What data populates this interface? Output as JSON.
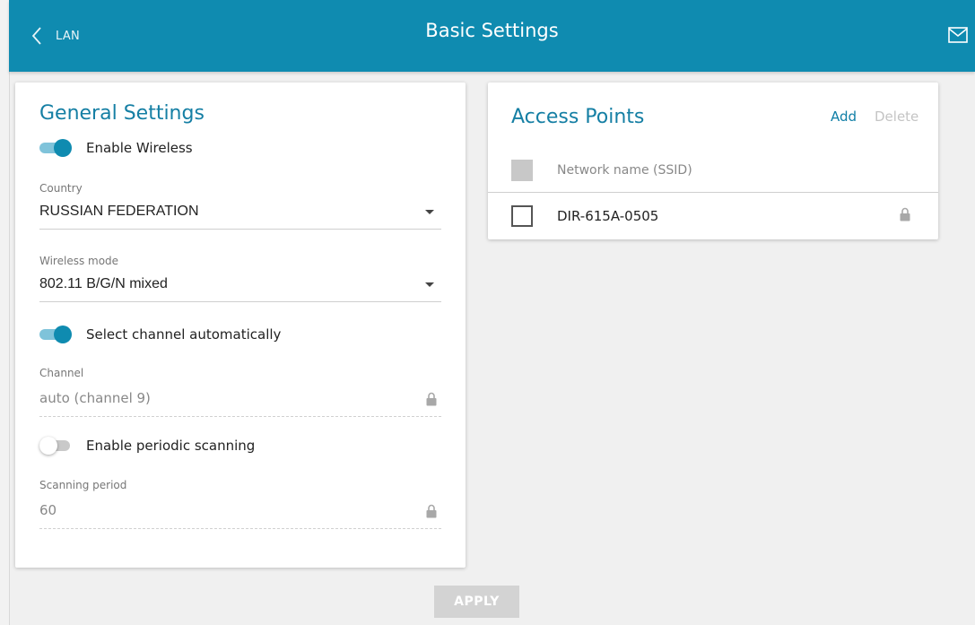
{
  "header": {
    "back_label": "LAN",
    "title": "Basic Settings"
  },
  "general": {
    "title": "General Settings",
    "enable_wireless": {
      "label": "Enable Wireless",
      "on": true
    },
    "country": {
      "label": "Country",
      "value": "RUSSIAN FEDERATION"
    },
    "wireless_mode": {
      "label": "Wireless mode",
      "value": "802.11 B/G/N mixed"
    },
    "auto_channel": {
      "label": "Select channel automatically",
      "on": true
    },
    "channel": {
      "label": "Channel",
      "value": "auto (channel 9)"
    },
    "periodic_scan": {
      "label": "Enable periodic scanning",
      "on": false
    },
    "scan_period": {
      "label": "Scanning period",
      "value": "60"
    }
  },
  "access_points": {
    "title": "Access Points",
    "add_label": "Add",
    "delete_label": "Delete",
    "column_header": "Network name (SSID)",
    "rows": [
      {
        "ssid": "DIR-615A-0505",
        "secured": true
      }
    ]
  },
  "apply_label": "APPLY",
  "colors": {
    "header_bg": "#0f8bb0",
    "accent": "#157fa4",
    "toggle_on": "#0f8bb0",
    "apply_disabled": "#d3d3d3"
  },
  "icons": {
    "back": "chevron-left-icon",
    "mail": "envelope-icon",
    "lock": "lock-icon"
  }
}
